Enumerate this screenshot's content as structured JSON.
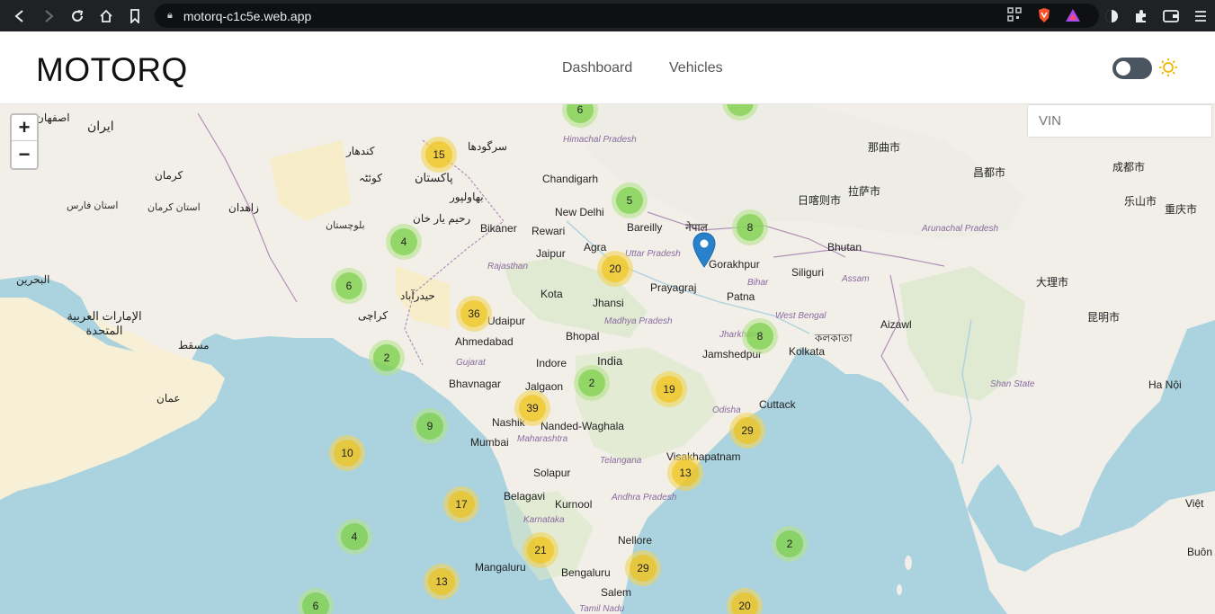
{
  "browser": {
    "url": "motorq-c1c5e.web.app"
  },
  "header": {
    "brand": "MOTORQ",
    "nav": [
      {
        "label": "Dashboard"
      },
      {
        "label": "Vehicles"
      }
    ]
  },
  "map": {
    "search_placeholder": "VIN",
    "zoom_in": "+",
    "zoom_out": "−",
    "clusters": [
      {
        "count": "6",
        "level": "small"
      },
      {
        "count": "15",
        "level": "medium"
      },
      {
        "count": "5",
        "level": "small"
      },
      {
        "count": "8",
        "level": "small"
      },
      {
        "count": "4",
        "level": "small"
      },
      {
        "count": "20",
        "level": "medium"
      },
      {
        "count": "6",
        "level": "small"
      },
      {
        "count": "36",
        "level": "medium"
      },
      {
        "count": "8",
        "level": "small"
      },
      {
        "count": "2",
        "level": "small"
      },
      {
        "count": "2",
        "level": "small"
      },
      {
        "count": "19",
        "level": "medium"
      },
      {
        "count": "39",
        "level": "medium"
      },
      {
        "count": "9",
        "level": "small"
      },
      {
        "count": "29",
        "level": "medium"
      },
      {
        "count": "10",
        "level": "medium"
      },
      {
        "count": "13",
        "level": "medium"
      },
      {
        "count": "17",
        "level": "medium"
      },
      {
        "count": "4",
        "level": "small"
      },
      {
        "count": "21",
        "level": "medium"
      },
      {
        "count": "2",
        "level": "small"
      },
      {
        "count": "29",
        "level": "medium"
      },
      {
        "count": "13",
        "level": "medium"
      },
      {
        "count": "6",
        "level": "small"
      },
      {
        "count": "20",
        "level": "medium"
      }
    ],
    "places": [
      "Chandigarh",
      "New Delhi",
      "Bikaner",
      "Rewari",
      "Bareilly",
      "Agra",
      "Jaipur",
      "Gorakhpur",
      "Siliguri",
      "Bhutan",
      "Prayagraj",
      "Patna",
      "Kota",
      "Jhansi",
      "Udaipur",
      "Ahmedabad",
      "Bhopal",
      "Indore",
      "India",
      "Jamshedpur",
      "Kolkata",
      "Bhavnagar",
      "Jalgaon",
      "Nashik",
      "Nanded-Waghala",
      "Cuttack",
      "Mumbai",
      "Visakhapatnam",
      "Solapur",
      "Belagavi",
      "Kurnool",
      "Nellore",
      "Mangaluru",
      "Bengaluru",
      "Salem",
      "Aizawl",
      "Shan State",
      "Ha Nội",
      "Việt",
      "Buôn",
      "Himachal Pradesh",
      "Uttar Pradesh",
      "Rajasthan",
      "Madhya Pradesh",
      "Gujarat",
      "Maharashtra",
      "Telangana",
      "Odisha",
      "Andhra Pradesh",
      "Karnataka",
      "Tamil Nadu",
      "Bihar",
      "Jharkhand",
      "West Bengal",
      "Assam",
      "Arunachal Pradesh",
      "नेपाल",
      "কলকাতা",
      "ایران",
      "اصفهان",
      "کرمان",
      "زاهدان",
      "پاکستان",
      "کراچی",
      "مسقط",
      "عمان",
      "البحرين",
      "الإمارات العربية المتحدة",
      "استان فارس",
      "استان کرمان",
      "بلوچستان",
      "حیدرآباد",
      "بهاولپور",
      "سرگودها",
      "کندهار",
      "کوئٹہ",
      "رحیم یار خان",
      "成都市",
      "昆明市",
      "重庆市",
      "乐山市",
      "大理市",
      "昌都市",
      "拉萨市",
      "日喀则市",
      "那曲市"
    ],
    "colors": {
      "water": "#aad3df",
      "land": "#f2efe9",
      "cluster_small": "#6ecc39",
      "cluster_medium": "#f0c20c",
      "marker": "#2a81cb"
    }
  }
}
